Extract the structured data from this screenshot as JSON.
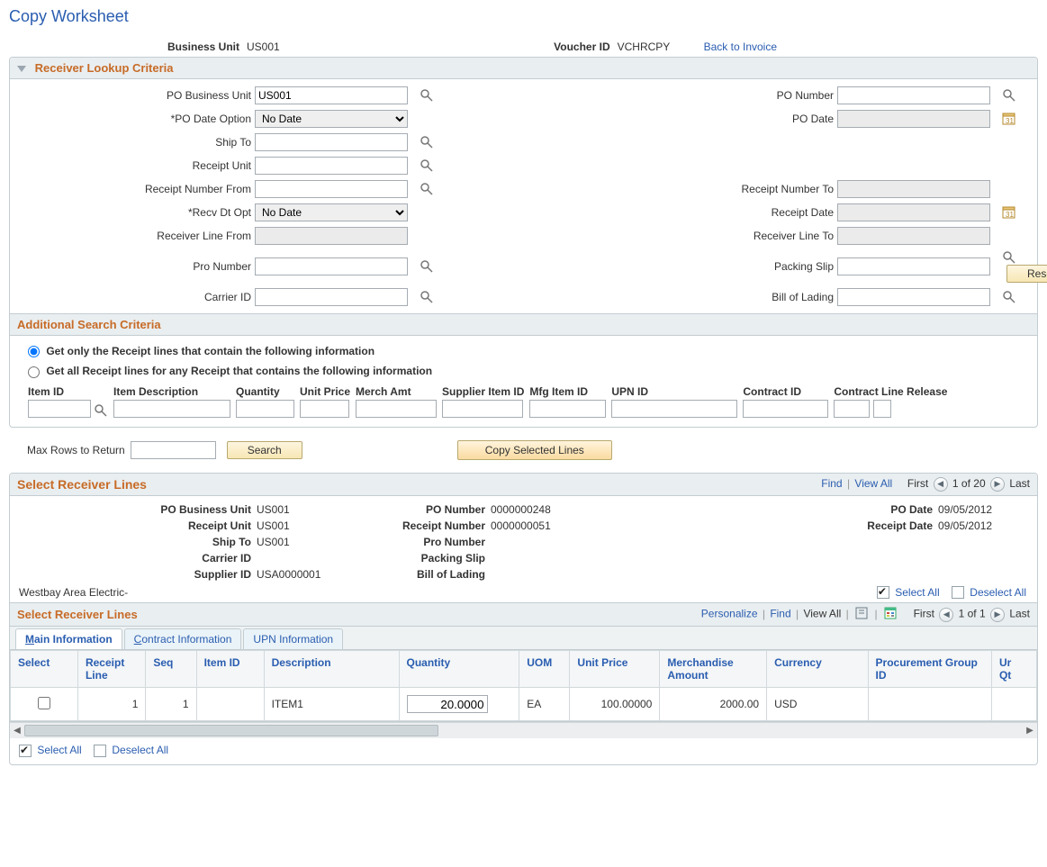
{
  "page": {
    "title": "Copy Worksheet",
    "business_unit_label": "Business Unit",
    "business_unit": "US001",
    "voucher_id_label": "Voucher ID",
    "voucher_id": "VCHRCPY",
    "back_link": "Back to Invoice"
  },
  "receiver_lookup": {
    "header": "Receiver Lookup Criteria",
    "labels": {
      "po_bu": "PO Business Unit",
      "po_number": "PO Number",
      "po_date_opt": "*PO Date Option",
      "po_date": "PO Date",
      "ship_to": "Ship To",
      "receipt_unit": "Receipt Unit",
      "receipt_num_from": "Receipt Number From",
      "receipt_num_to": "Receipt Number To",
      "recv_dt_opt": "*Recv Dt Opt",
      "receipt_date": "Receipt Date",
      "recv_line_from": "Receiver Line From",
      "recv_line_to": "Receiver Line To",
      "pro_number": "Pro Number",
      "packing_slip": "Packing Slip",
      "carrier_id": "Carrier ID",
      "bill_of_lading": "Bill of Lading"
    },
    "values": {
      "po_bu": "US001",
      "po_date_opt": "No Date",
      "recv_dt_opt": "No Date"
    },
    "reset_btn": "Reset"
  },
  "additional": {
    "header": "Additional Search Criteria",
    "radio1": "Get only the Receipt lines that contain the following information",
    "radio2": "Get all Receipt lines for any Receipt that contains the following information",
    "cols": {
      "item_id": "Item ID",
      "item_desc": "Item Description",
      "qty": "Quantity",
      "unit_price": "Unit Price",
      "merch": "Merch Amt",
      "supplier_item": "Supplier Item ID",
      "mfg_item": "Mfg Item ID",
      "upn": "UPN ID",
      "contract_id": "Contract ID",
      "contract_line_rel": "Contract Line Release"
    }
  },
  "mid": {
    "max_rows_label": "Max Rows to Return",
    "search_btn": "Search",
    "copy_btn": "Copy Selected Lines"
  },
  "select_lines": {
    "header": "Select Receiver Lines",
    "nav": {
      "find": "Find",
      "view_all": "View All",
      "first": "First",
      "count": "1 of 20",
      "last": "Last"
    },
    "info_labels": {
      "po_bu": "PO Business Unit",
      "po_number": "PO Number",
      "po_date": "PO Date",
      "receipt_unit": "Receipt Unit",
      "receipt_number": "Receipt Number",
      "receipt_date": "Receipt Date",
      "ship_to": "Ship To",
      "pro_number": "Pro Number",
      "carrier_id": "Carrier ID",
      "packing_slip": "Packing Slip",
      "supplier_id": "Supplier ID",
      "bill_of_lading": "Bill of Lading"
    },
    "info_values": {
      "po_bu": "US001",
      "po_number": "0000000248",
      "po_date": "09/05/2012",
      "receipt_unit": "US001",
      "receipt_number": "0000000051",
      "receipt_date": "09/05/2012",
      "ship_to": "US001",
      "pro_number": "",
      "carrier_id": "",
      "packing_slip": "",
      "supplier_id": "USA0000001",
      "bill_of_lading": ""
    },
    "supplier_name": "Westbay Area Electric-",
    "select_all": "Select All",
    "deselect_all": "Deselect All"
  },
  "inner_grid": {
    "header": "Select Receiver Lines",
    "toolbar": {
      "personalize": "Personalize",
      "find": "Find",
      "view_all": "View All",
      "first": "First",
      "count": "1 of 1",
      "last": "Last"
    },
    "tabs": {
      "main": "Main Information",
      "contract": "Contract Information",
      "upn": "UPN Information"
    },
    "columns": {
      "select": "Select",
      "receipt_line": "Receipt Line",
      "seq": "Seq",
      "item_id": "Item ID",
      "description": "Description",
      "quantity": "Quantity",
      "uom": "UOM",
      "unit_price": "Unit Price",
      "merch_amt": "Merchandise Amount",
      "currency": "Currency",
      "proc_grp": "Procurement Group ID",
      "unit_qty": "Unit Qty"
    },
    "row": {
      "receipt_line": "1",
      "seq": "1",
      "item_id": "",
      "description": "ITEM1",
      "quantity": "20.0000",
      "uom": "EA",
      "unit_price": "100.00000",
      "merch_amt": "2000.00",
      "currency": "USD",
      "proc_grp": ""
    }
  }
}
